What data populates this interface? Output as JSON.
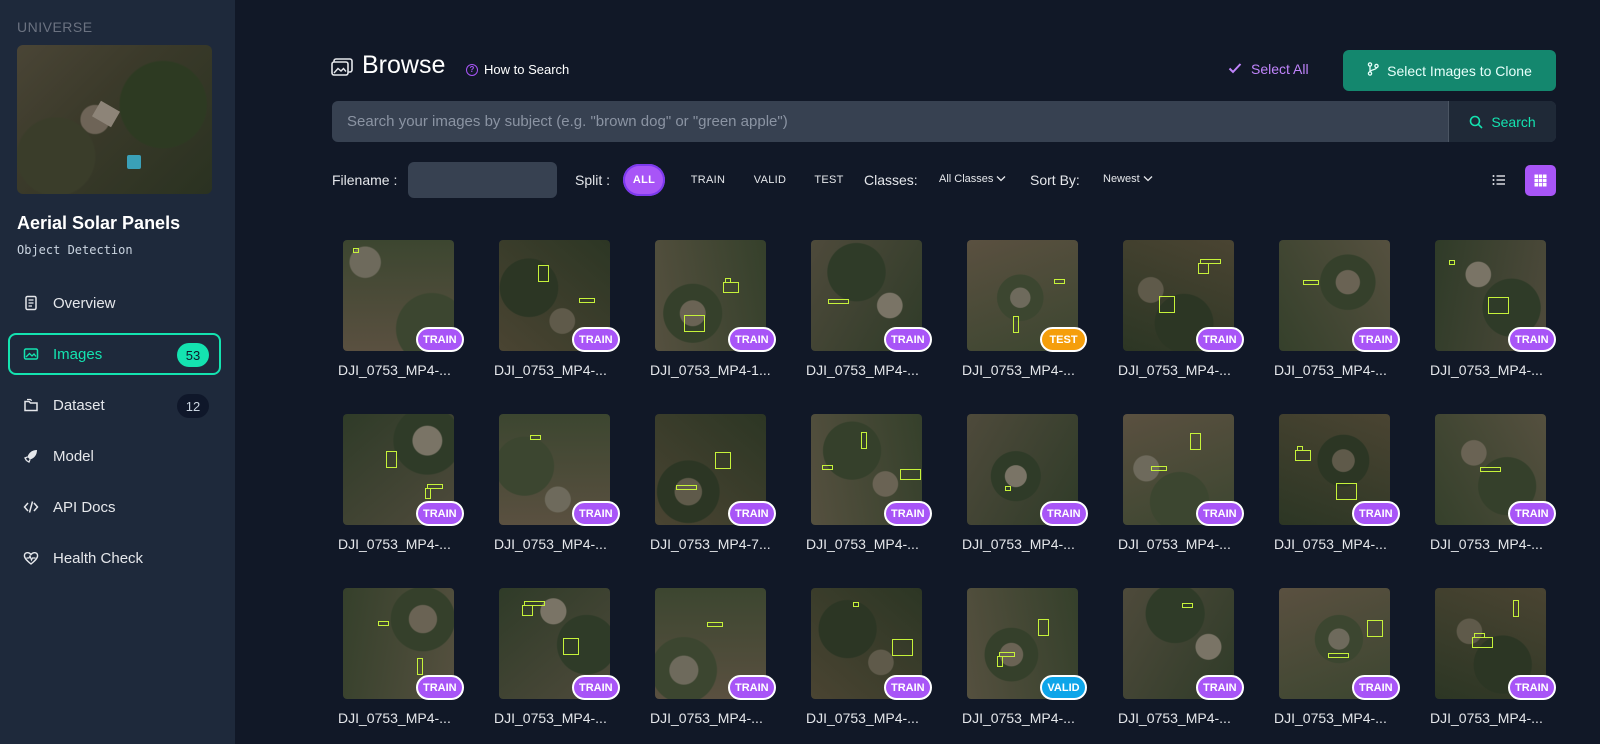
{
  "sidebar": {
    "brand": "UNIVERSE",
    "project_name": "Aerial Solar Panels",
    "project_type": "Object Detection",
    "items": [
      {
        "label": "Overview",
        "icon": "document-icon"
      },
      {
        "label": "Images",
        "icon": "images-icon",
        "badge": "53",
        "active": true
      },
      {
        "label": "Dataset",
        "icon": "folders-icon",
        "badge": "12"
      },
      {
        "label": "Model",
        "icon": "rocket-icon"
      },
      {
        "label": "API Docs",
        "icon": "code-icon"
      },
      {
        "label": "Health Check",
        "icon": "heart-pulse-icon"
      }
    ]
  },
  "header": {
    "title": "Browse",
    "how_to": "How to Search",
    "select_all": "Select All",
    "clone_button": "Select Images to Clone"
  },
  "search": {
    "placeholder": "Search your images by subject (e.g. \"brown dog\" or \"green apple\")",
    "button": "Search"
  },
  "filters": {
    "filename_label": "Filename :",
    "split_label": "Split :",
    "splits": [
      "ALL",
      "TRAIN",
      "VALID",
      "TEST"
    ],
    "active_split": "ALL",
    "classes_label": "Classes:",
    "classes_value": "All Classes",
    "sort_label": "Sort By:",
    "sort_value": "Newest"
  },
  "colors": {
    "accent": "#14e3b0",
    "purple": "#a855f7",
    "train": "#a855f7",
    "test": "#f59e0b",
    "valid": "#0ea5e9"
  },
  "images": [
    {
      "name": "DJI_0753_MP4-...",
      "split": "TRAIN"
    },
    {
      "name": "DJI_0753_MP4-...",
      "split": "TRAIN"
    },
    {
      "name": "DJI_0753_MP4-1...",
      "split": "TRAIN"
    },
    {
      "name": "DJI_0753_MP4-...",
      "split": "TRAIN"
    },
    {
      "name": "DJI_0753_MP4-...",
      "split": "TEST"
    },
    {
      "name": "DJI_0753_MP4-...",
      "split": "TRAIN"
    },
    {
      "name": "DJI_0753_MP4-...",
      "split": "TRAIN"
    },
    {
      "name": "DJI_0753_MP4-...",
      "split": "TRAIN"
    },
    {
      "name": "DJI_0753_MP4-...",
      "split": "TRAIN"
    },
    {
      "name": "DJI_0753_MP4-...",
      "split": "TRAIN"
    },
    {
      "name": "DJI_0753_MP4-7...",
      "split": "TRAIN"
    },
    {
      "name": "DJI_0753_MP4-...",
      "split": "TRAIN"
    },
    {
      "name": "DJI_0753_MP4-...",
      "split": "TRAIN"
    },
    {
      "name": "DJI_0753_MP4-...",
      "split": "TRAIN"
    },
    {
      "name": "DJI_0753_MP4-...",
      "split": "TRAIN"
    },
    {
      "name": "DJI_0753_MP4-...",
      "split": "TRAIN"
    },
    {
      "name": "DJI_0753_MP4-...",
      "split": "TRAIN"
    },
    {
      "name": "DJI_0753_MP4-...",
      "split": "TRAIN"
    },
    {
      "name": "DJI_0753_MP4-...",
      "split": "TRAIN"
    },
    {
      "name": "DJI_0753_MP4-...",
      "split": "TRAIN"
    },
    {
      "name": "DJI_0753_MP4-...",
      "split": "VALID"
    },
    {
      "name": "DJI_0753_MP4-...",
      "split": "TRAIN"
    },
    {
      "name": "DJI_0753_MP4-...",
      "split": "TRAIN"
    },
    {
      "name": "DJI_0753_MP4-...",
      "split": "TRAIN"
    }
  ]
}
